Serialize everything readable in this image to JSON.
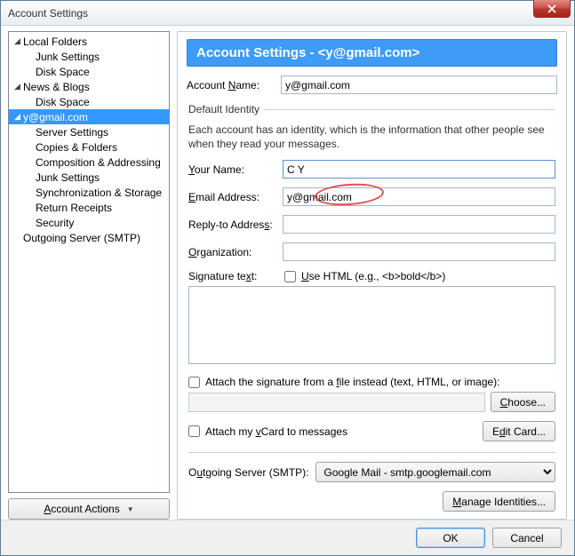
{
  "window": {
    "title": "Account Settings"
  },
  "sidebar": {
    "items": [
      {
        "label": "Local Folders",
        "level": 1,
        "expandable": true
      },
      {
        "label": "Junk Settings",
        "level": 2
      },
      {
        "label": "Disk Space",
        "level": 2
      },
      {
        "label": "News & Blogs",
        "level": 1,
        "expandable": true
      },
      {
        "label": "Disk Space",
        "level": 2
      },
      {
        "label": "y@gmail.com",
        "level": 1,
        "expandable": true,
        "selected": true
      },
      {
        "label": "Server Settings",
        "level": 2
      },
      {
        "label": "Copies & Folders",
        "level": 2
      },
      {
        "label": "Composition & Addressing",
        "level": 2
      },
      {
        "label": "Junk Settings",
        "level": 2
      },
      {
        "label": "Synchronization & Storage",
        "level": 2
      },
      {
        "label": "Return Receipts",
        "level": 2
      },
      {
        "label": "Security",
        "level": 2
      },
      {
        "label": "Outgoing Server (SMTP)",
        "level": 1
      }
    ],
    "account_actions": "Account Actions"
  },
  "main": {
    "banner": "Account Settings - <y@gmail.com>",
    "account_name_label": "Account Name:",
    "account_name_value": "y@gmail.com",
    "identity_legend": "Default Identity",
    "identity_desc": "Each account has an identity, which is the information that other people see when they read your messages.",
    "your_name_label": "Your Name:",
    "your_name_value": "C Y",
    "email_label": "Email Address:",
    "email_value": "y@gmail.com",
    "reply_label": "Reply-to Address:",
    "reply_value": "",
    "org_label": "Organization:",
    "org_value": "",
    "sig_label": "Signature text:",
    "use_html_label": "Use HTML (e.g., <b>bold</b>)",
    "sig_value": "",
    "attach_file_label": "Attach the signature from a file instead (text, HTML, or image):",
    "choose_label": "Choose...",
    "attach_vcard_label": "Attach my vCard to messages",
    "edit_card_label": "Edit Card...",
    "smtp_label": "Outgoing Server (SMTP):",
    "smtp_value": "Google Mail - smtp.googlemail.com",
    "manage_label": "Manage Identities..."
  },
  "footer": {
    "ok": "OK",
    "cancel": "Cancel"
  }
}
